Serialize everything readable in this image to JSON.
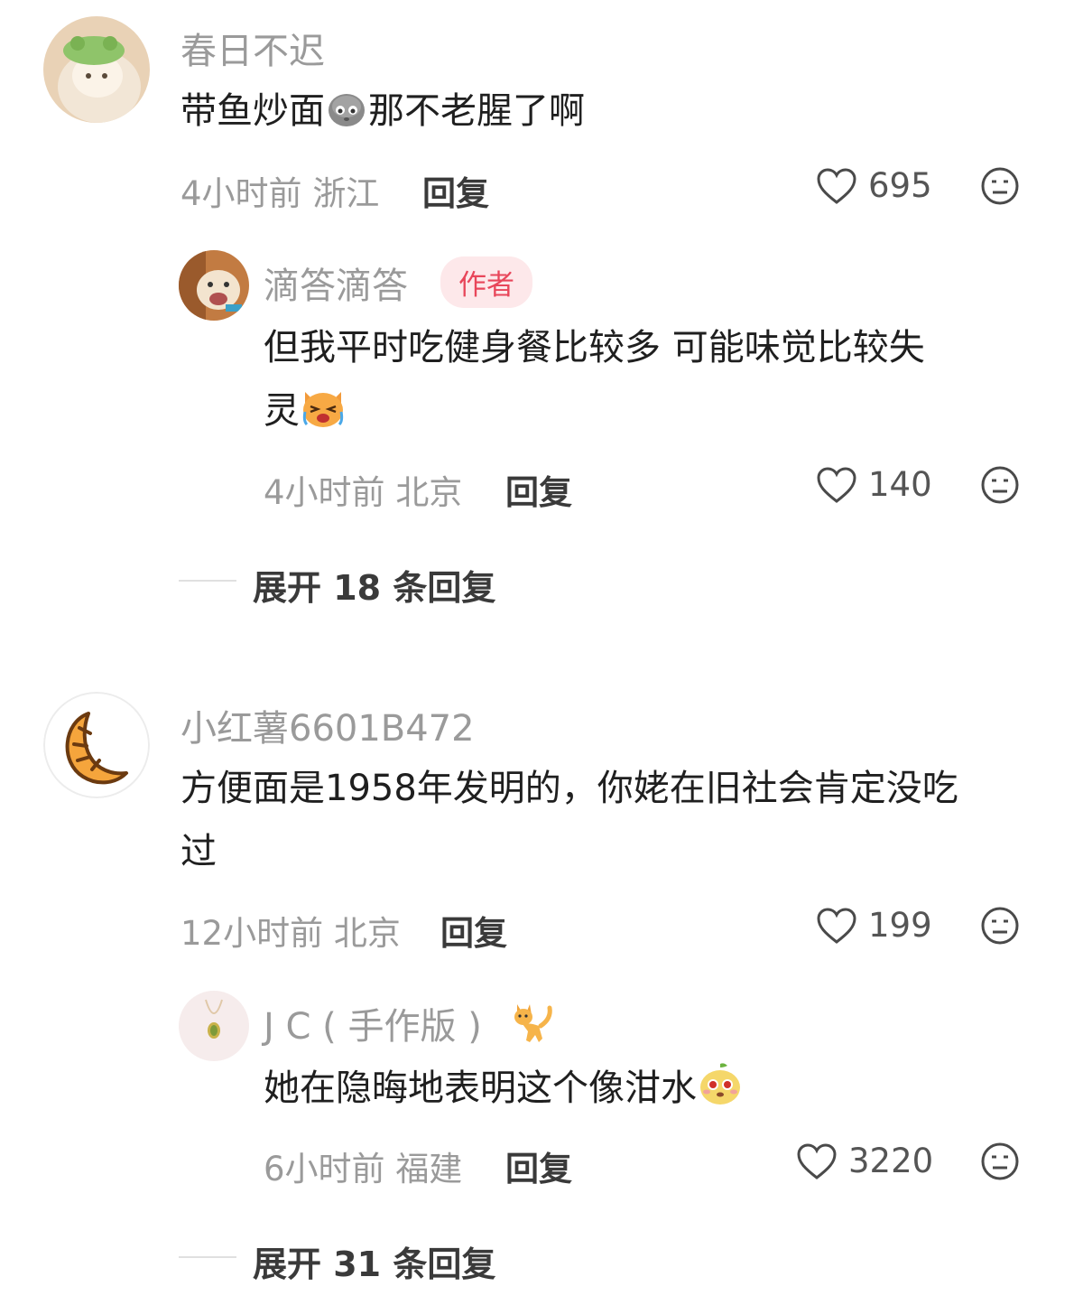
{
  "comments": [
    {
      "user": "春日不迟",
      "text_before": "带鱼炒面",
      "emoji": "rock-face-emoji",
      "text_after": "那不老腥了啊",
      "time": "4小时前",
      "location": "浙江",
      "reply": "回复",
      "likes": "695",
      "replies": [
        {
          "user": "滴答滴答",
          "tag": "作者",
          "text_line1": "但我平时吃健身餐比较多 可能味觉比较失",
          "text_line2": "灵",
          "emoji": "crying-cat-emoji",
          "time": "4小时前",
          "location": "北京",
          "reply": "回复",
          "likes": "140"
        }
      ],
      "expand": "展开 18 条回复"
    },
    {
      "user": "小红薯6601B472",
      "text_line1": "方便面是1958年发明的，你姥在旧社会肯定没吃",
      "text_line2": "过",
      "time": "12小时前",
      "location": "北京",
      "reply": "回复",
      "likes": "199",
      "replies": [
        {
          "user": "J C ( 手作版 )",
          "badge": "cat-emoji",
          "text": "她在隐晦地表明这个像泔水",
          "emoji": "pear-face-emoji",
          "time": "6小时前",
          "location": "福建",
          "reply": "回复",
          "likes": "3220"
        }
      ],
      "expand": "展开 31 条回复"
    }
  ],
  "colors": {
    "name": "#9a9a9a",
    "text": "#1f1f1f",
    "author_tag_bg": "#fde8ea",
    "author_tag_text": "#e8465a"
  },
  "icons": {
    "like": "heart-outline-icon",
    "dislike": "meh-face-icon"
  }
}
